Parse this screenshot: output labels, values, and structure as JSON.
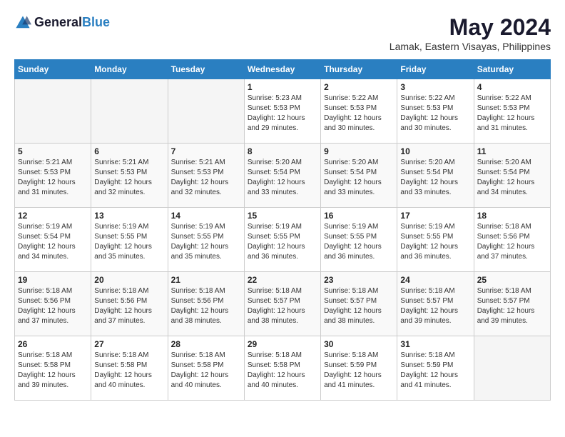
{
  "logo": {
    "line1": "General",
    "line2": "Blue"
  },
  "title": "May 2024",
  "location": "Lamak, Eastern Visayas, Philippines",
  "days_of_week": [
    "Sunday",
    "Monday",
    "Tuesday",
    "Wednesday",
    "Thursday",
    "Friday",
    "Saturday"
  ],
  "weeks": [
    {
      "days": [
        {
          "num": "",
          "empty": true
        },
        {
          "num": "",
          "empty": true
        },
        {
          "num": "",
          "empty": true
        },
        {
          "num": "1",
          "sunrise": "5:23 AM",
          "sunset": "5:53 PM",
          "daylight": "12 hours and 29 minutes."
        },
        {
          "num": "2",
          "sunrise": "5:22 AM",
          "sunset": "5:53 PM",
          "daylight": "12 hours and 30 minutes."
        },
        {
          "num": "3",
          "sunrise": "5:22 AM",
          "sunset": "5:53 PM",
          "daylight": "12 hours and 30 minutes."
        },
        {
          "num": "4",
          "sunrise": "5:22 AM",
          "sunset": "5:53 PM",
          "daylight": "12 hours and 31 minutes."
        }
      ]
    },
    {
      "days": [
        {
          "num": "5",
          "sunrise": "5:21 AM",
          "sunset": "5:53 PM",
          "daylight": "12 hours and 31 minutes."
        },
        {
          "num": "6",
          "sunrise": "5:21 AM",
          "sunset": "5:53 PM",
          "daylight": "12 hours and 32 minutes."
        },
        {
          "num": "7",
          "sunrise": "5:21 AM",
          "sunset": "5:53 PM",
          "daylight": "12 hours and 32 minutes."
        },
        {
          "num": "8",
          "sunrise": "5:20 AM",
          "sunset": "5:54 PM",
          "daylight": "12 hours and 33 minutes."
        },
        {
          "num": "9",
          "sunrise": "5:20 AM",
          "sunset": "5:54 PM",
          "daylight": "12 hours and 33 minutes."
        },
        {
          "num": "10",
          "sunrise": "5:20 AM",
          "sunset": "5:54 PM",
          "daylight": "12 hours and 33 minutes."
        },
        {
          "num": "11",
          "sunrise": "5:20 AM",
          "sunset": "5:54 PM",
          "daylight": "12 hours and 34 minutes."
        }
      ]
    },
    {
      "days": [
        {
          "num": "12",
          "sunrise": "5:19 AM",
          "sunset": "5:54 PM",
          "daylight": "12 hours and 34 minutes."
        },
        {
          "num": "13",
          "sunrise": "5:19 AM",
          "sunset": "5:55 PM",
          "daylight": "12 hours and 35 minutes."
        },
        {
          "num": "14",
          "sunrise": "5:19 AM",
          "sunset": "5:55 PM",
          "daylight": "12 hours and 35 minutes."
        },
        {
          "num": "15",
          "sunrise": "5:19 AM",
          "sunset": "5:55 PM",
          "daylight": "12 hours and 36 minutes."
        },
        {
          "num": "16",
          "sunrise": "5:19 AM",
          "sunset": "5:55 PM",
          "daylight": "12 hours and 36 minutes."
        },
        {
          "num": "17",
          "sunrise": "5:19 AM",
          "sunset": "5:55 PM",
          "daylight": "12 hours and 36 minutes."
        },
        {
          "num": "18",
          "sunrise": "5:18 AM",
          "sunset": "5:56 PM",
          "daylight": "12 hours and 37 minutes."
        }
      ]
    },
    {
      "days": [
        {
          "num": "19",
          "sunrise": "5:18 AM",
          "sunset": "5:56 PM",
          "daylight": "12 hours and 37 minutes."
        },
        {
          "num": "20",
          "sunrise": "5:18 AM",
          "sunset": "5:56 PM",
          "daylight": "12 hours and 37 minutes."
        },
        {
          "num": "21",
          "sunrise": "5:18 AM",
          "sunset": "5:56 PM",
          "daylight": "12 hours and 38 minutes."
        },
        {
          "num": "22",
          "sunrise": "5:18 AM",
          "sunset": "5:57 PM",
          "daylight": "12 hours and 38 minutes."
        },
        {
          "num": "23",
          "sunrise": "5:18 AM",
          "sunset": "5:57 PM",
          "daylight": "12 hours and 38 minutes."
        },
        {
          "num": "24",
          "sunrise": "5:18 AM",
          "sunset": "5:57 PM",
          "daylight": "12 hours and 39 minutes."
        },
        {
          "num": "25",
          "sunrise": "5:18 AM",
          "sunset": "5:57 PM",
          "daylight": "12 hours and 39 minutes."
        }
      ]
    },
    {
      "days": [
        {
          "num": "26",
          "sunrise": "5:18 AM",
          "sunset": "5:58 PM",
          "daylight": "12 hours and 39 minutes."
        },
        {
          "num": "27",
          "sunrise": "5:18 AM",
          "sunset": "5:58 PM",
          "daylight": "12 hours and 40 minutes."
        },
        {
          "num": "28",
          "sunrise": "5:18 AM",
          "sunset": "5:58 PM",
          "daylight": "12 hours and 40 minutes."
        },
        {
          "num": "29",
          "sunrise": "5:18 AM",
          "sunset": "5:58 PM",
          "daylight": "12 hours and 40 minutes."
        },
        {
          "num": "30",
          "sunrise": "5:18 AM",
          "sunset": "5:59 PM",
          "daylight": "12 hours and 41 minutes."
        },
        {
          "num": "31",
          "sunrise": "5:18 AM",
          "sunset": "5:59 PM",
          "daylight": "12 hours and 41 minutes."
        },
        {
          "num": "",
          "empty": true
        }
      ]
    }
  ],
  "labels": {
    "sunrise_prefix": "Sunrise: ",
    "sunset_prefix": "Sunset: ",
    "daylight_prefix": "Daylight: "
  }
}
